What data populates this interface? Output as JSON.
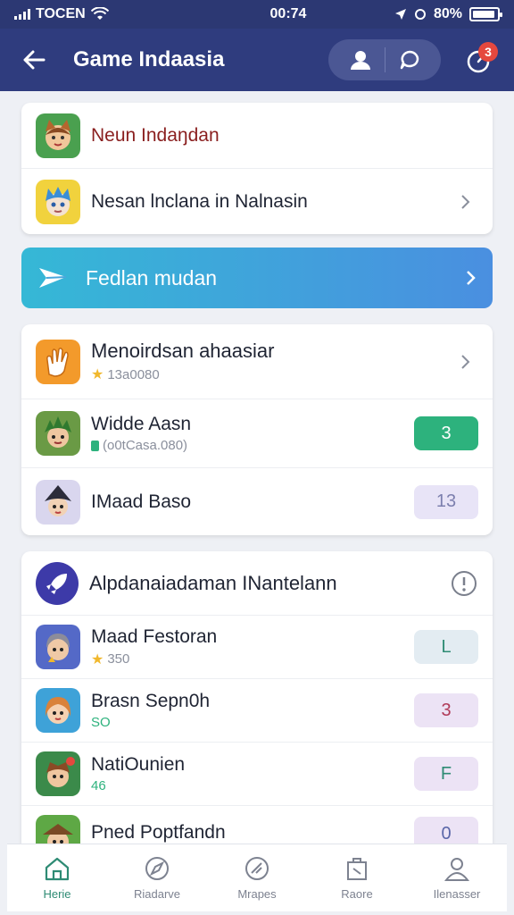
{
  "status_bar": {
    "carrier": "TOCEN",
    "time": "00:74",
    "battery": "80%"
  },
  "header": {
    "title": "Game Indaasia",
    "notification_count": "3"
  },
  "card1": {
    "items": [
      {
        "title": "Neun Indaŋdan"
      },
      {
        "title": "Nesan lnclana in Nalnasin"
      }
    ]
  },
  "banner": {
    "title": "Fedlan mudan"
  },
  "card2": {
    "header": {
      "title": "Menoirdsan ahaasiar",
      "sub": "13a0080"
    },
    "items": [
      {
        "title": "Widde Aasn",
        "sub": "(o0tCasa.080)",
        "count": "3"
      },
      {
        "title": "IMaad Baso",
        "count": "13"
      }
    ]
  },
  "card3": {
    "header": {
      "title": "Alpdanaiadaman INantelann"
    },
    "items": [
      {
        "title": "Maad Festoran",
        "sub": "350",
        "badge": "L"
      },
      {
        "title": "Brasn Sepn0h",
        "sub": "SO",
        "badge": "3"
      },
      {
        "title": "NatiOunien",
        "sub": "46",
        "badge": "F"
      },
      {
        "title": "Pned Poptfandn",
        "badge": "0"
      }
    ]
  },
  "nav": [
    {
      "label": "Herie",
      "icon": "home-icon"
    },
    {
      "label": "Riadarve",
      "icon": "compass-icon"
    },
    {
      "label": "Mrapes",
      "icon": "map-icon"
    },
    {
      "label": "Raore",
      "icon": "store-icon"
    },
    {
      "label": "Ilenasser",
      "icon": "profile-icon"
    }
  ],
  "colors": {
    "header": "#2f3c7e",
    "accent_green": "#2db27d",
    "nav_active": "#2e8b74",
    "badge_red": "#e5483e"
  }
}
